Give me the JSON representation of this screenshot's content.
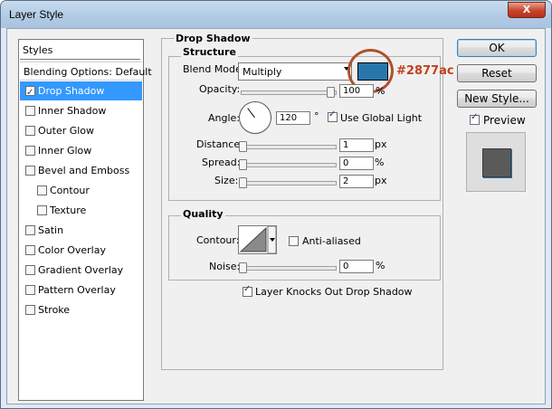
{
  "window": {
    "title": "Layer Style",
    "close_label": "X"
  },
  "sidebar": {
    "header": "Styles",
    "items": [
      {
        "label": "Blending Options: Default",
        "checkbox": false,
        "checked": false,
        "selected": false
      },
      {
        "label": "Drop Shadow",
        "checkbox": true,
        "checked": true,
        "selected": true
      },
      {
        "label": "Inner Shadow",
        "checkbox": true,
        "checked": false,
        "selected": false
      },
      {
        "label": "Outer Glow",
        "checkbox": true,
        "checked": false,
        "selected": false
      },
      {
        "label": "Inner Glow",
        "checkbox": true,
        "checked": false,
        "selected": false
      },
      {
        "label": "Bevel and Emboss",
        "checkbox": true,
        "checked": false,
        "selected": false
      },
      {
        "label": "Contour",
        "checkbox": true,
        "checked": false,
        "selected": false,
        "indent": true
      },
      {
        "label": "Texture",
        "checkbox": true,
        "checked": false,
        "selected": false,
        "indent": true
      },
      {
        "label": "Satin",
        "checkbox": true,
        "checked": false,
        "selected": false
      },
      {
        "label": "Color Overlay",
        "checkbox": true,
        "checked": false,
        "selected": false
      },
      {
        "label": "Gradient Overlay",
        "checkbox": true,
        "checked": false,
        "selected": false
      },
      {
        "label": "Pattern Overlay",
        "checkbox": true,
        "checked": false,
        "selected": false
      },
      {
        "label": "Stroke",
        "checkbox": true,
        "checked": false,
        "selected": false
      }
    ]
  },
  "drop_shadow": {
    "title": "Drop Shadow",
    "structure": {
      "title": "Structure",
      "blend_mode_label": "Blend Mode:",
      "blend_mode_value": "Multiply",
      "shadow_color": "#2877ac",
      "color_annotation": "#2877ac",
      "opacity_label": "Opacity:",
      "opacity_value": "100",
      "opacity_unit": "%",
      "angle_label": "Angle:",
      "angle_value": "120",
      "angle_unit": "°",
      "use_global_light_label": "Use Global Light",
      "use_global_light": true,
      "distance_label": "Distance:",
      "distance_value": "1",
      "distance_unit": "px",
      "spread_label": "Spread:",
      "spread_value": "0",
      "spread_unit": "%",
      "size_label": "Size:",
      "size_value": "2",
      "size_unit": "px"
    },
    "quality": {
      "title": "Quality",
      "contour_label": "Contour:",
      "anti_aliased_label": "Anti-aliased",
      "anti_aliased": false,
      "noise_label": "Noise:",
      "noise_value": "0",
      "noise_unit": "%"
    },
    "knocks_out_label": "Layer Knocks Out Drop Shadow",
    "knocks_out": true
  },
  "buttons": {
    "ok": "OK",
    "reset": "Reset",
    "new_style": "New Style...",
    "preview_label": "Preview",
    "preview_checked": true
  }
}
